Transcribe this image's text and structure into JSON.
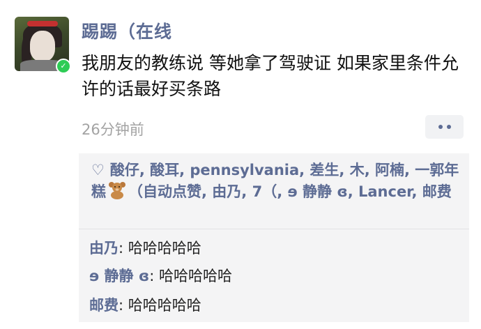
{
  "post": {
    "username": "踢踢（在线",
    "text": "我朋友的教练说 等她拿了驾驶证 如果家里条件允许的话最好买条路",
    "timestamp": "26分钟前",
    "avatar_icon": "anime-avatar",
    "online_icon": "online-check-icon",
    "more_icon": "more-dots-icon"
  },
  "likes": {
    "icon": "heart-icon",
    "names_part1": "酸仔, 酸耳, pennsylvania, 差生, 木, 阿楠, 一郭年糕",
    "emoji_icon": "teddy-bear-icon",
    "names_part2": "（自动点赞, 由乃, 7（, ɘ 静静 ɞ, Lancer, 邮费"
  },
  "comments": [
    {
      "author": "由乃",
      "separator": ": ",
      "text": "哈哈哈哈哈"
    },
    {
      "author": "ɘ 静静 ɞ",
      "separator": ": ",
      "text": "哈哈哈哈哈"
    },
    {
      "author": "邮费",
      "separator": ": ",
      "text": "哈哈哈哈哈"
    }
  ],
  "colors": {
    "link": "#5d6c94",
    "online": "#2ecc55",
    "panel": "#f4f4f5"
  }
}
